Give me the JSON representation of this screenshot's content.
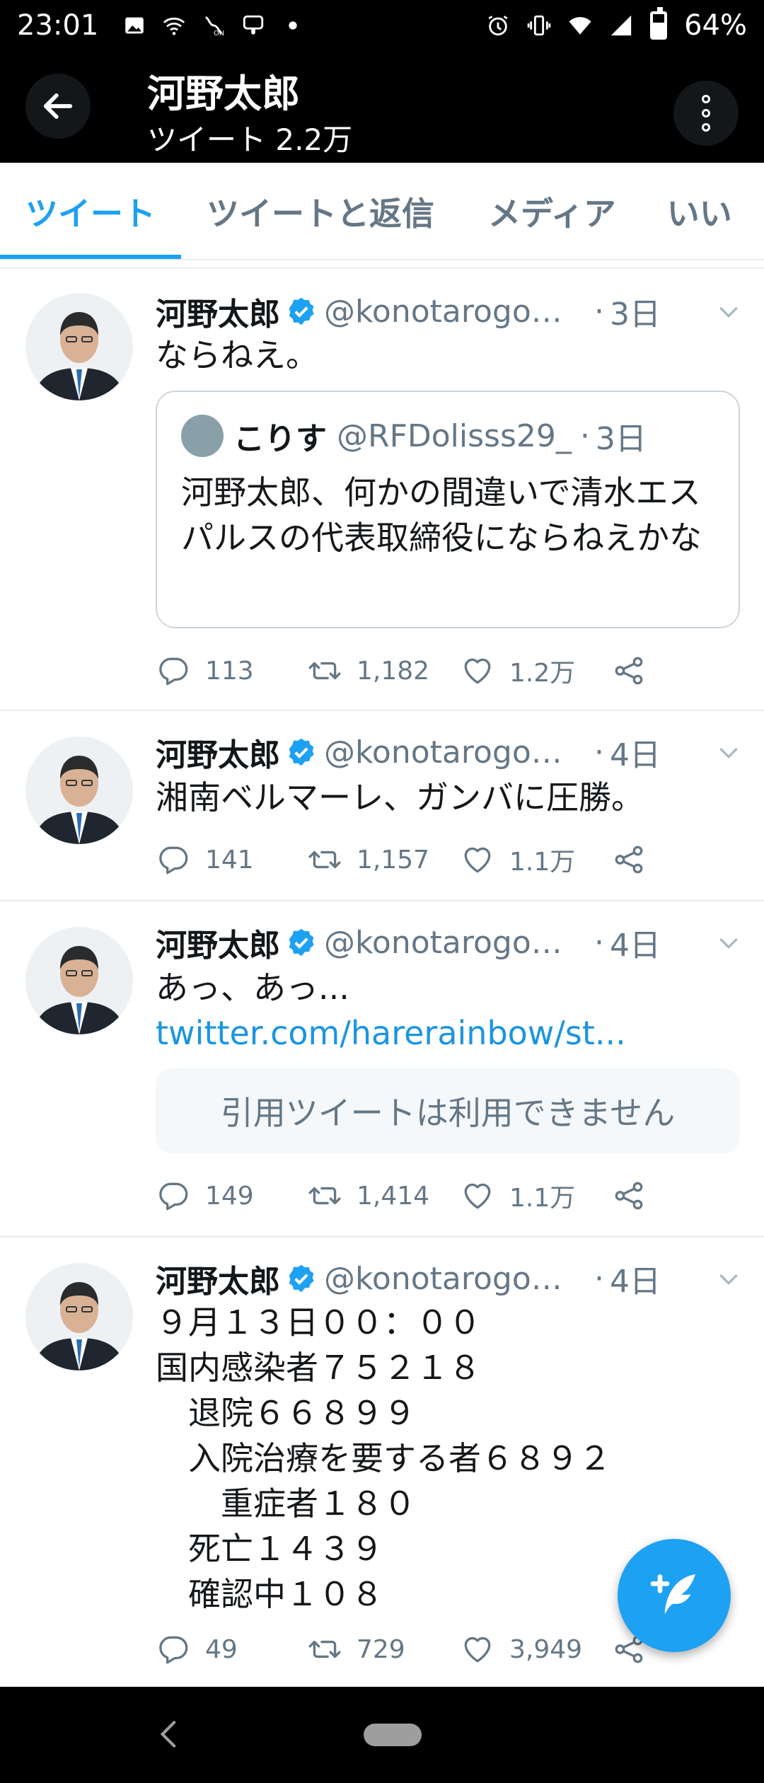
{
  "status_bar": {
    "time": "23:01",
    "battery": "64%",
    "battery_level": 0.64
  },
  "header": {
    "title": "河野太郎",
    "subtitle": "ツイート 2.2万"
  },
  "tabs": [
    {
      "label": "ツイート",
      "active": true
    },
    {
      "label": "ツイートと返信",
      "active": false
    },
    {
      "label": "メディア",
      "active": false
    },
    {
      "label": "いい",
      "active": false
    }
  ],
  "colors": {
    "accent": "#1da1f2",
    "link": "#1b95e0",
    "muted": "#657786"
  },
  "icons": {
    "back": "arrow-left-icon",
    "more": "more-vertical-icon",
    "verified": "verified-badge-icon",
    "caret": "chevron-down-icon",
    "reply": "reply-icon",
    "retweet": "retweet-icon",
    "like": "heart-icon",
    "share": "share-icon",
    "compose": "compose-tweet-icon"
  },
  "tweets": [
    {
      "name": "河野太郎",
      "handle": "@konotarogom...",
      "time": "3日",
      "text": "ならねえ。",
      "quote": {
        "name": "こりす",
        "handle": "@RFDolisss29_",
        "time": "3日",
        "text": "河野太郎、何かの間違いで清水エスパルスの代表取締役にならねえかな"
      },
      "replies": "113",
      "retweets": "1,182",
      "likes": "1.2万"
    },
    {
      "name": "河野太郎",
      "handle": "@konotarogom...",
      "time": "4日",
      "text": "湘南ベルマーレ、ガンバに圧勝。",
      "replies": "141",
      "retweets": "1,157",
      "likes": "1.1万"
    },
    {
      "name": "河野太郎",
      "handle": "@konotarogom...",
      "time": "4日",
      "text_prefix": "あっ、あっ... ",
      "link": "twitter.com/harerainbow/st...",
      "unavailable": "引用ツイートは利用できません",
      "replies": "149",
      "retweets": "1,414",
      "likes": "1.1万"
    },
    {
      "name": "河野太郎",
      "handle": "@konotarogom...",
      "time": "4日",
      "text": "９月１３日００：００\n国内感染者７５２１８\n　退院６６８９９\n　入院治療を要する者６８９２\n　　重症者１８０\n　死亡１４３９\n　確認中１０８",
      "replies": "49",
      "retweets": "729",
      "likes": "3,949"
    }
  ]
}
